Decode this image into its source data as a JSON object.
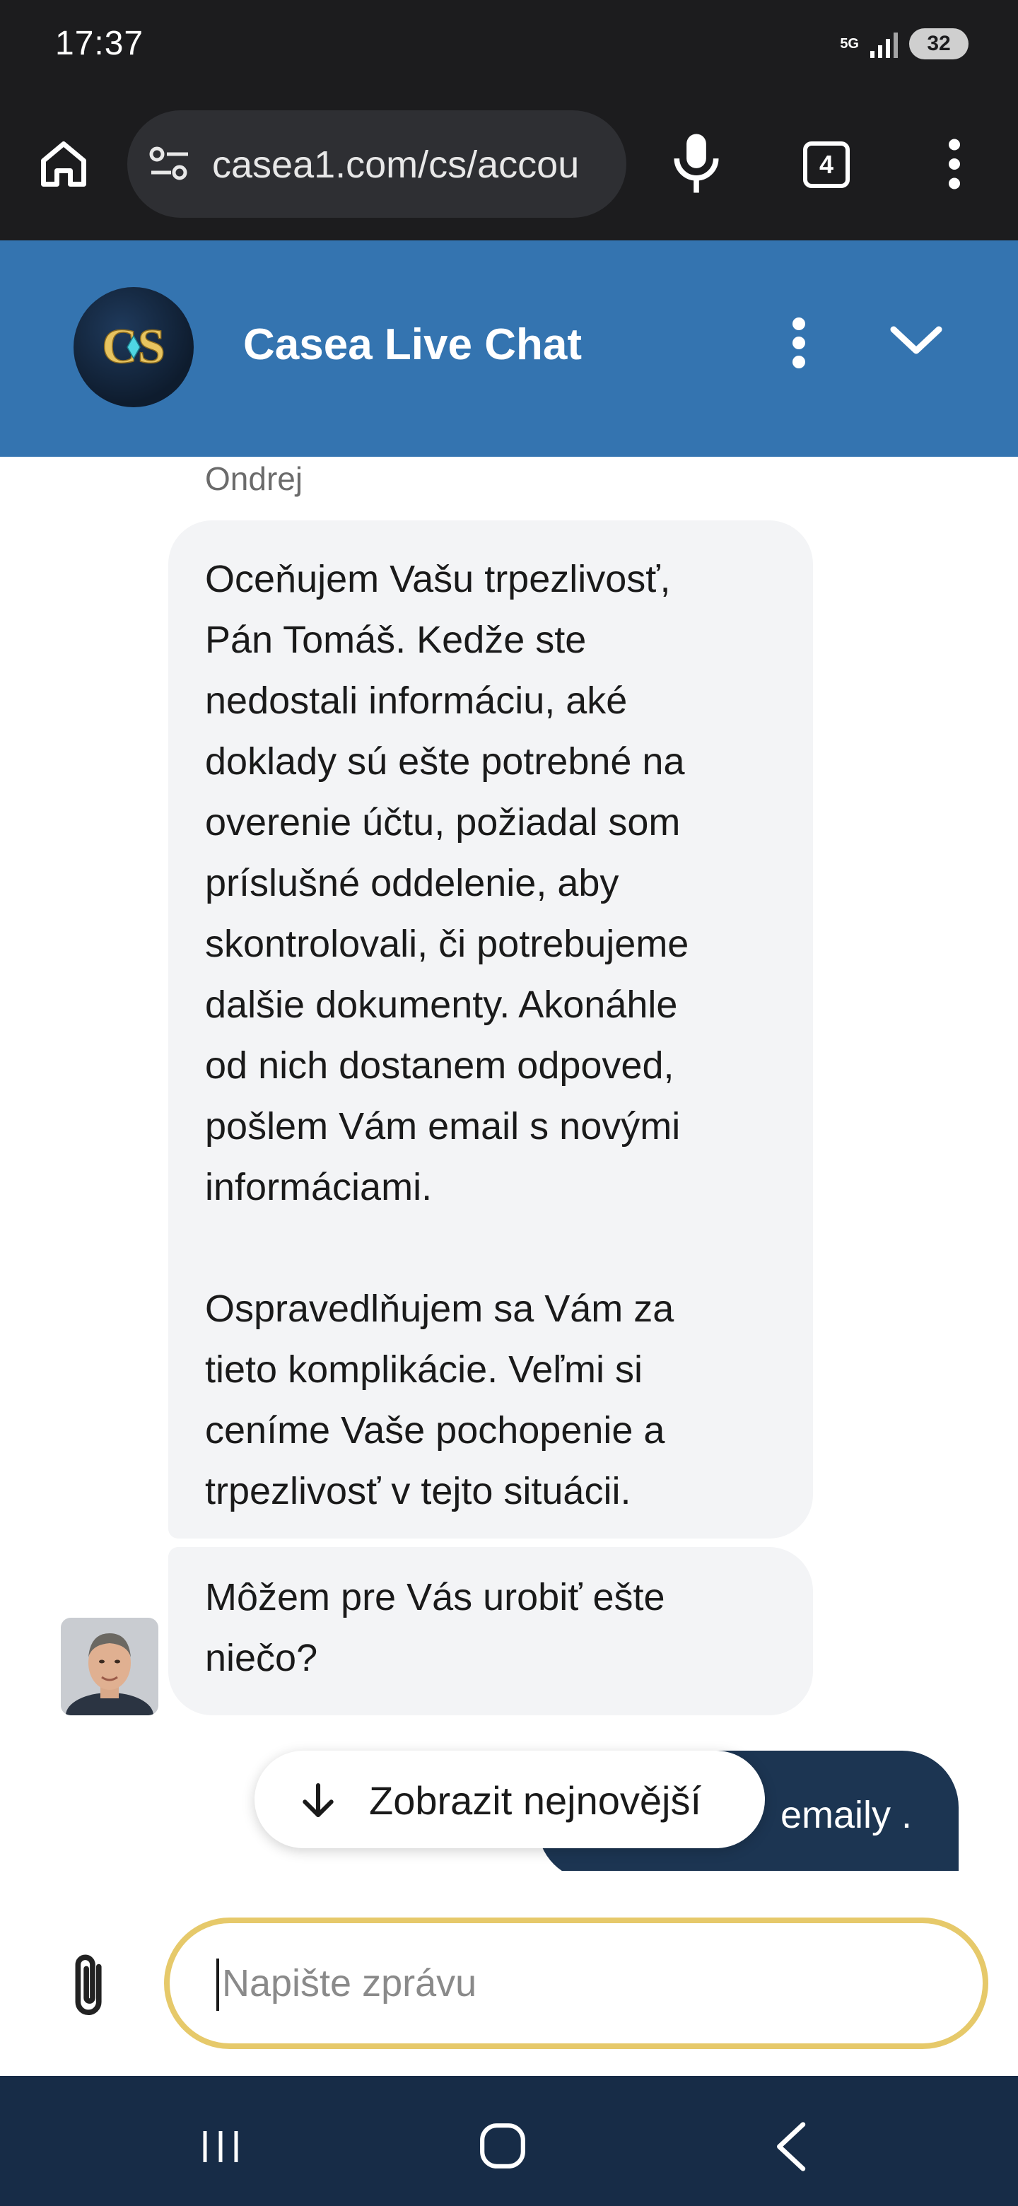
{
  "status_bar": {
    "time": "17:37",
    "network": "5G",
    "battery": "32"
  },
  "browser": {
    "url": "casea1.com/cs/accou",
    "tab_count": "4"
  },
  "chat_header": {
    "title": "Casea Live Chat",
    "logo_text": "CS"
  },
  "messages": {
    "agent_name": "Ondrej",
    "agent_message_1": {
      "lines_a": [
        "Oceňujem Vašu trpezlivosť,",
        "Pán Tomáš. Kedže ste",
        "nedostali informáciu, aké",
        "doklady sú ešte potrebné na",
        "overenie účtu, požiadal som",
        "príslušné oddelenie, aby",
        "skontrolovali, či potrebujeme",
        "dalšie dokumenty. Akonáhle",
        "od nich dostanem odpoved,",
        "pošlem Vám email s novými",
        "informáciami."
      ],
      "lines_b": [
        "Ospravedlňujem sa Vám za",
        "tieto komplikácie. Veľmi si",
        "ceníme Vaše pochopenie a",
        "trpezlivosť v tejto situácii."
      ]
    },
    "agent_message_2": [
      "Môžem pre Vás urobiť ešte",
      "niečo?"
    ],
    "user_message_partial": "emaily ."
  },
  "scroll_button": {
    "label": "Zobrazit nejnovější"
  },
  "composer": {
    "placeholder": "Napište zprávu"
  },
  "colors": {
    "header": "#3474b0",
    "user_bubble": "#1c3552",
    "input_border": "#e6c96a",
    "nav": "#172c47"
  },
  "icons": [
    "home-icon",
    "tune-icon",
    "mic-icon",
    "tabs-icon",
    "more-vert-icon",
    "chevron-down-icon",
    "arrow-down-icon",
    "paperclip-icon",
    "recents-icon",
    "home-nav-icon",
    "back-icon"
  ]
}
